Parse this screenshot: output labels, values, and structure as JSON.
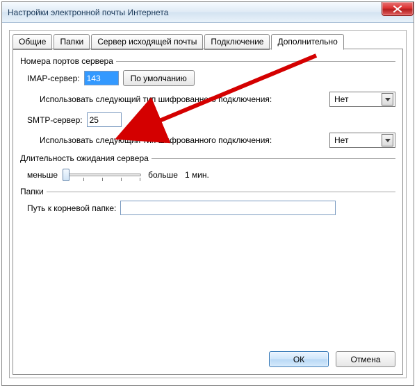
{
  "window": {
    "title": "Настройки электронной почты Интернета"
  },
  "tabs": {
    "general": "Общие",
    "folders": "Папки",
    "outgoing": "Сервер исходящей почты",
    "connection": "Подключение",
    "advanced": "Дополнительно"
  },
  "ports": {
    "group_label": "Номера портов сервера",
    "imap_label": "IMAP-сервер:",
    "imap_value": "143",
    "default_btn": "По умолчанию",
    "enc_label": "Использовать следующий тип шифрованного подключения:",
    "enc_imap_value": "Нет",
    "smtp_label": "SMTP-сервер:",
    "smtp_value": "25",
    "enc_smtp_value": "Нет"
  },
  "timeout": {
    "group_label": "Длительность ожидания сервера",
    "less": "меньше",
    "more": "больше",
    "value": "1 мин."
  },
  "folders": {
    "group_label": "Папки",
    "root_label": "Путь к корневой папке:",
    "root_value": ""
  },
  "footer": {
    "ok": "ОК",
    "cancel": "Отмена"
  }
}
